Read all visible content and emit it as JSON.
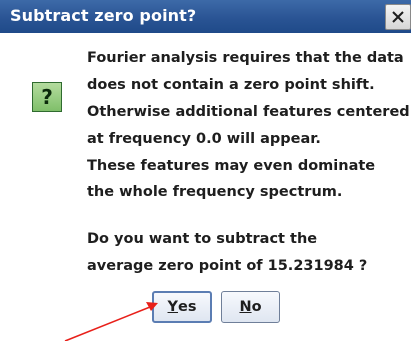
{
  "dialog": {
    "title": "Subtract zero point?",
    "close_icon": "close-x-icon",
    "icon": "question-mark-icon",
    "icon_glyph": "?",
    "icon_color": "#7fbf6a",
    "title_bar_color": "#2a5494",
    "message_lines": [
      "Fourier analysis requires that the data",
      "does not contain a zero point shift.",
      "Otherwise additional features centered",
      "at frequency 0.0 will appear.",
      "These features may even dominate",
      "the whole frequency spectrum.",
      "",
      "Do you want to subtract the",
      "average zero point of 15.231984 ?"
    ],
    "buttons": {
      "yes": {
        "mnemonic": "Y",
        "rest": "es"
      },
      "no": {
        "mnemonic": "N",
        "rest": "o"
      }
    },
    "annotation": {
      "type": "arrow",
      "color": "#e8201a",
      "points_to": "yes-button"
    }
  }
}
